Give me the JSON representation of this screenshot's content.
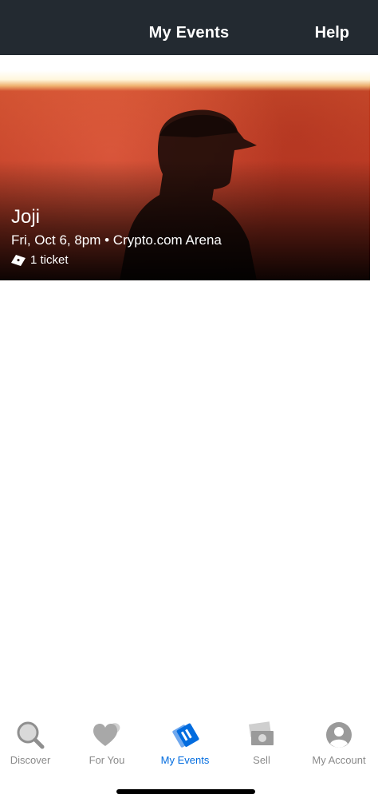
{
  "header": {
    "title": "My Events",
    "help_label": "Help"
  },
  "event": {
    "name": "Joji",
    "meta": "Fri, Oct 6, 8pm • Crypto.com Arena",
    "tickets": "1 ticket",
    "ticket_icon": "ticket-icon"
  },
  "tabs": [
    {
      "label": "Discover",
      "icon": "search-icon"
    },
    {
      "label": "For You",
      "icon": "heart-icon"
    },
    {
      "label": "My Events",
      "icon": "tickets-icon"
    },
    {
      "label": "Sell",
      "icon": "money-icon"
    },
    {
      "label": "My Account",
      "icon": "account-icon"
    }
  ],
  "colors": {
    "header_bg": "#232a31",
    "active_tab": "#026cdf",
    "inactive_tab": "#8a8a8a"
  }
}
